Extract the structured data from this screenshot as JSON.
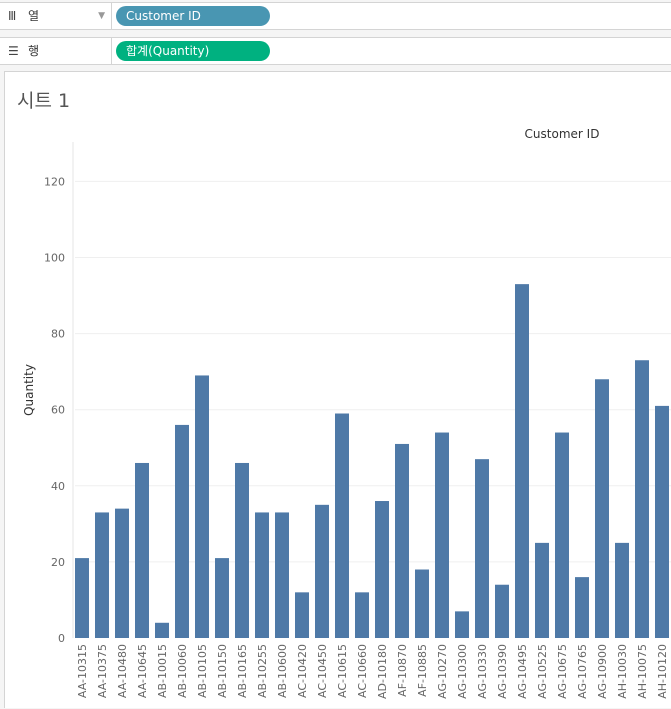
{
  "columns_shelf": {
    "icon": "columns-icon",
    "label": "열",
    "pill": "Customer ID"
  },
  "rows_shelf": {
    "icon": "rows-icon",
    "label": "행",
    "pill": "합계(Quantity)"
  },
  "sheet": {
    "title": "시트 1"
  },
  "colors": {
    "bar": "#4e79a7",
    "blue_pill": "#4996b2",
    "green_pill": "#00b180"
  },
  "chart_data": {
    "type": "bar",
    "title": "Customer ID",
    "xlabel": "",
    "ylabel": "Quantity",
    "ylim": [
      0,
      130
    ],
    "yticks": [
      0,
      20,
      40,
      60,
      80,
      100,
      120
    ],
    "grid": true,
    "categories": [
      "AA-10315",
      "AA-10375",
      "AA-10480",
      "AA-10645",
      "AB-10015",
      "AB-10060",
      "AB-10105",
      "AB-10150",
      "AB-10165",
      "AB-10255",
      "AB-10600",
      "AC-10420",
      "AC-10450",
      "AC-10615",
      "AC-10660",
      "AD-10180",
      "AF-10870",
      "AF-10885",
      "AG-10270",
      "AG-10300",
      "AG-10330",
      "AG-10390",
      "AG-10495",
      "AG-10525",
      "AG-10675",
      "AG-10765",
      "AG-10900",
      "AH-10030",
      "AH-10075",
      "AH-10120"
    ],
    "values": [
      21,
      33,
      34,
      46,
      4,
      56,
      69,
      21,
      46,
      33,
      33,
      12,
      35,
      59,
      12,
      36,
      51,
      18,
      54,
      7,
      47,
      14,
      93,
      25,
      54,
      16,
      68,
      25,
      73,
      61
    ]
  }
}
